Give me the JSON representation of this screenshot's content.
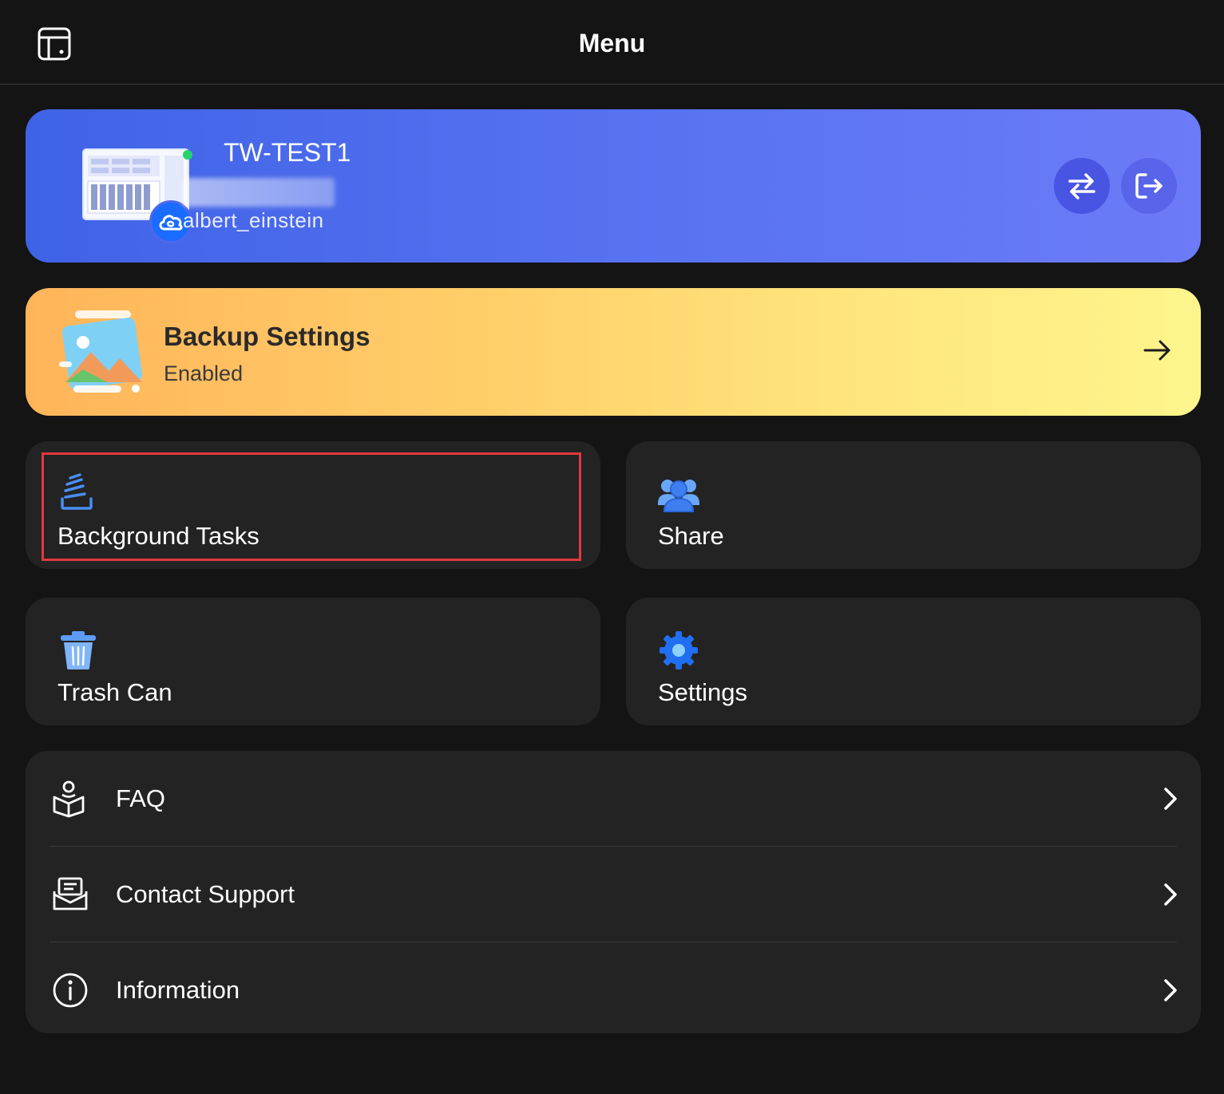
{
  "header": {
    "title": "Menu",
    "toggle_icon": "sidebar-layout-icon"
  },
  "device": {
    "name": "TW-TEST1",
    "status_color": "#27d36b",
    "user": "albert_einstein",
    "icons": {
      "device": "nas-device-icon",
      "badge": "cloud-icon",
      "switch": "switch-arrows-icon",
      "logout": "logout-icon"
    }
  },
  "backup": {
    "title": "Backup Settings",
    "status": "Enabled",
    "icons": {
      "main": "photo-backup-icon",
      "go": "arrow-right-icon"
    }
  },
  "tiles": [
    {
      "label": "Background Tasks",
      "icon": "background-tasks-icon",
      "highlighted": true
    },
    {
      "label": "Share",
      "icon": "share-users-icon"
    },
    {
      "label": "Trash Can",
      "icon": "trash-icon"
    },
    {
      "label": "Settings",
      "icon": "gear-icon"
    }
  ],
  "list": [
    {
      "label": "FAQ",
      "icon": "faq-book-icon"
    },
    {
      "label": "Contact Support",
      "icon": "contact-support-icon"
    },
    {
      "label": "Information",
      "icon": "info-icon"
    }
  ],
  "colors": {
    "background": "#141414",
    "card": "#232323",
    "device_card": "#4d67ec",
    "backup_gradient_start": "#ffb45a",
    "backup_gradient_end": "#fdf58c",
    "highlight": "#e0393e"
  }
}
